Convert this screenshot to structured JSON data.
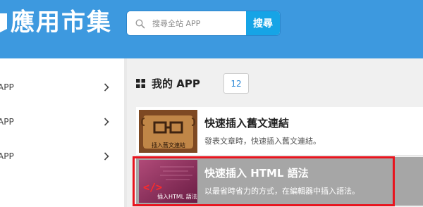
{
  "header": {
    "title": "應用市集",
    "search_placeholder": "搜尋全站 APP",
    "search_button": "搜尋"
  },
  "sidebar": {
    "items": [
      {
        "label": "APP"
      },
      {
        "label": "APP"
      },
      {
        "label": "APP"
      }
    ]
  },
  "main": {
    "section_title": "我的 APP",
    "count": "12",
    "apps": [
      {
        "name": "快速插入舊文連結",
        "description": "發表文章時，快速插入舊文連結。",
        "thumb_label": "插入舊文連結"
      },
      {
        "name": "快速插入 HTML 語法",
        "description": "以最省時省力的方式，在編輯器中插入語法。",
        "thumb_label": "插入HTML 語法"
      }
    ]
  },
  "colors": {
    "header_bg": "#3d99df",
    "search_button_bg": "#16a4e6",
    "highlight": "#e8141e",
    "selected_row_bg": "#a6a6a6"
  }
}
